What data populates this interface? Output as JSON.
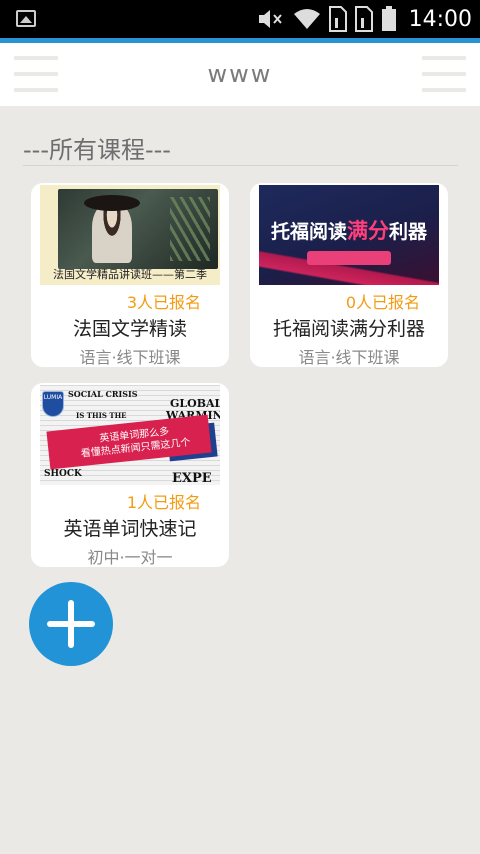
{
  "status_bar": {
    "time": "14:00",
    "icons": [
      "image-icon",
      "mute-icon",
      "wifi-icon",
      "sim1-icon",
      "sim2-icon",
      "battery-icon"
    ]
  },
  "app_bar": {
    "title": "www",
    "left_icon": "menu-icon",
    "right_icon": "menu-icon"
  },
  "section": {
    "title": "---所有课程---"
  },
  "courses": [
    {
      "enrolled": "3人已报名",
      "name": "法国文学精读",
      "category": "语言·线下班课",
      "thumb_caption": "法国文学精品讲读班——第二季"
    },
    {
      "enrolled": "0人已报名",
      "name": "托福阅读满分利器",
      "category": "语言·线下班课",
      "thumb_head_a": "托福阅读",
      "thumb_head_b": "满分",
      "thumb_head_c": "利器"
    },
    {
      "enrolled": "1人已报名",
      "name": "英语单词快速记",
      "category": "初中·一对一",
      "thumb_line1": "英语单词那么多",
      "thumb_line2": "看懂热点新闻只需这几个",
      "thumb_words": [
        "SOCIAL CRISIS",
        "GLOBAL",
        "WARMING",
        "IS THIS THE",
        "SHOCK",
        "EXPE"
      ],
      "thumb_logo": "LUMIA"
    }
  ],
  "fab": {
    "icon": "plus-icon"
  },
  "colors": {
    "accent": "#2a93d5",
    "fab": "#2293d6",
    "enrolled_text": "#f39c12",
    "background": "#ebe9e6"
  }
}
